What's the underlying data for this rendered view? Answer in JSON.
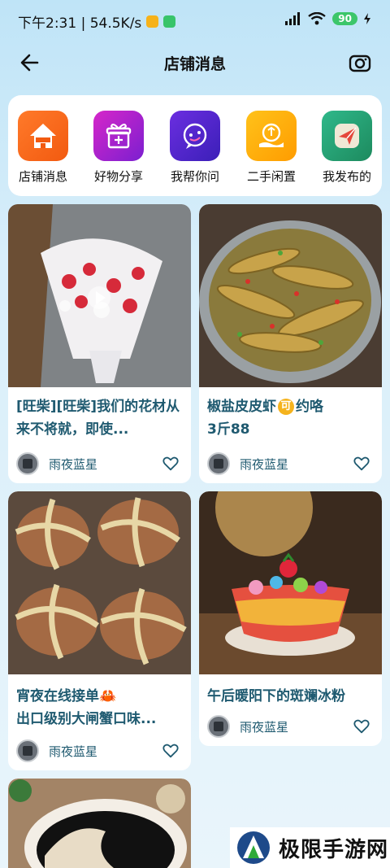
{
  "status": {
    "time_speed": "下午2:31 | 54.5K/s",
    "battery": "90"
  },
  "header": {
    "title": "店铺消息"
  },
  "categories": [
    {
      "label": "店铺消息",
      "icon": "shop-news-icon"
    },
    {
      "label": "好物分享",
      "icon": "gift-icon"
    },
    {
      "label": "我帮你问",
      "icon": "chat-bubble-icon"
    },
    {
      "label": "二手闲置",
      "icon": "recycle-icon"
    },
    {
      "label": "我发布的",
      "icon": "paper-plane-icon"
    }
  ],
  "feed": [
    {
      "title": "[旺柴][旺柴]我们的花材从来不将就，即使...",
      "author": "雨夜蓝星",
      "image": "flower-bouquet-image"
    },
    {
      "title_part1": "椒盐皮皮虾",
      "badge": "可",
      "title_part2": "约咯",
      "title_line2": "3斤88",
      "author": "雨夜蓝星",
      "image": "mantis-shrimp-image"
    },
    {
      "title_line1": "宵夜在线接单🦀",
      "title_line2": "出口级别大闸蟹口味...",
      "author": "雨夜蓝星",
      "image": "hairy-crab-image"
    },
    {
      "title": "午后暖阳下的斑斓冰粉",
      "author": "雨夜蓝星",
      "image": "jelly-dessert-image"
    },
    {
      "image": "black-sesame-paste-image"
    }
  ],
  "watermark": {
    "text": "极限手游网"
  },
  "colors": {
    "accent_text": "#1f5a70",
    "battery": "#3cc66a",
    "background_top": "#bfe4f7"
  }
}
